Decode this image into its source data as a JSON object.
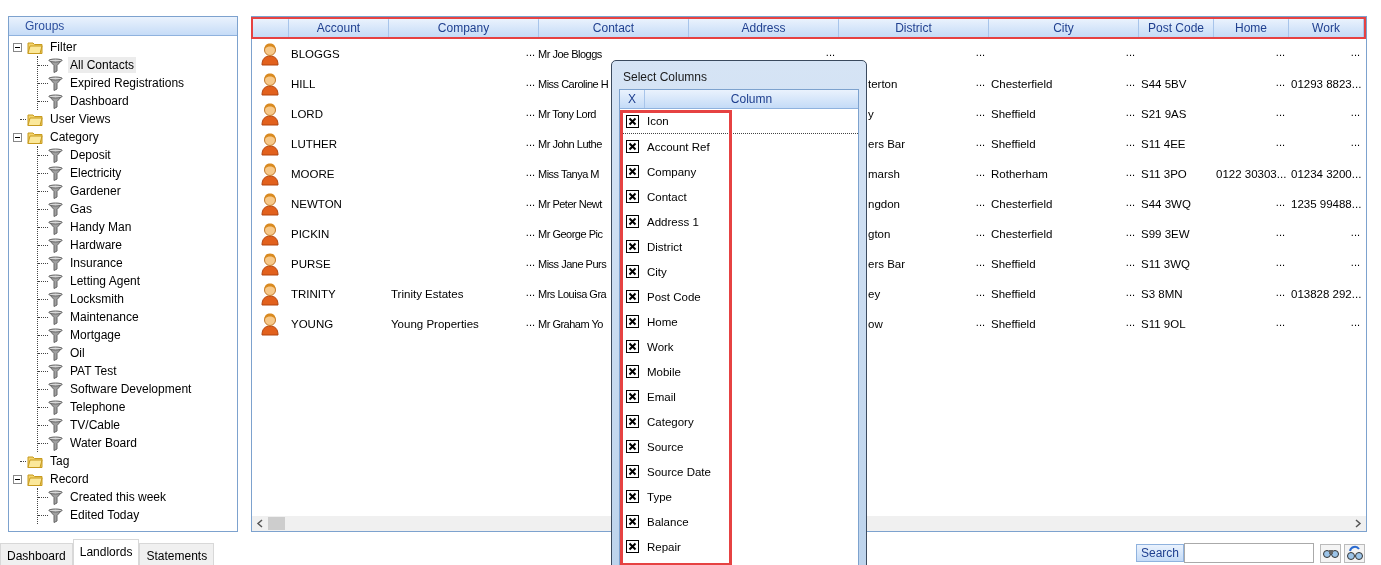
{
  "groups": {
    "title": "Groups",
    "items": [
      {
        "label": "Filter",
        "selected": false,
        "expanded": true,
        "children": [
          {
            "label": "All Contacts",
            "selected": true
          },
          {
            "label": "Expired Registrations",
            "selected": false
          },
          {
            "label": "Dashboard",
            "selected": false
          }
        ]
      },
      {
        "label": "User Views",
        "selected": false
      },
      {
        "label": "Category",
        "selected": false,
        "expanded": true,
        "children": [
          {
            "label": "Deposit",
            "selected": false
          },
          {
            "label": "Electricity",
            "selected": false
          },
          {
            "label": "Gardener",
            "selected": false
          },
          {
            "label": "Gas",
            "selected": false
          },
          {
            "label": "Handy Man",
            "selected": false
          },
          {
            "label": "Hardware",
            "selected": false
          },
          {
            "label": "Insurance",
            "selected": false
          },
          {
            "label": "Letting Agent",
            "selected": false
          },
          {
            "label": "Locksmith",
            "selected": false
          },
          {
            "label": "Maintenance",
            "selected": false
          },
          {
            "label": "Mortgage",
            "selected": false
          },
          {
            "label": "Oil",
            "selected": false
          },
          {
            "label": "PAT Test",
            "selected": false
          },
          {
            "label": "Software Development",
            "selected": false
          },
          {
            "label": "Telephone",
            "selected": false
          },
          {
            "label": "TV/Cable",
            "selected": false
          },
          {
            "label": "Water Board",
            "selected": false
          }
        ]
      },
      {
        "label": "Tag",
        "selected": false
      },
      {
        "label": "Record",
        "selected": false,
        "expanded": true,
        "children": [
          {
            "label": "Created this week",
            "selected": false
          },
          {
            "label": "Edited Today",
            "selected": false
          }
        ]
      }
    ]
  },
  "table": {
    "columns": [
      "Account",
      "Company",
      "Contact",
      "Address",
      "District",
      "City",
      "Post Code",
      "Home",
      "Work"
    ],
    "rows": [
      {
        "cells": [
          {
            "text": "BLOGGS"
          },
          {
            "more": "..."
          },
          {
            "text": "Mr Joe Bloggs"
          },
          {
            "more": "..."
          },
          {
            "more": "..."
          },
          {
            "more": "..."
          },
          {},
          {
            "more": "..."
          },
          {
            "more": "..."
          }
        ]
      },
      {
        "cells": [
          {
            "text": "HILL"
          },
          {
            "more": "..."
          },
          {
            "text": "Miss Caroline H"
          },
          {},
          {
            "text": "terton",
            "more": "..."
          },
          {
            "text": "Chesterfield",
            "more": "..."
          },
          {
            "text": "S44 5BV"
          },
          {
            "more": "..."
          },
          {
            "text": "01293 8823..."
          }
        ]
      },
      {
        "cells": [
          {
            "text": "LORD"
          },
          {
            "more": "..."
          },
          {
            "text": "Mr Tony Lord"
          },
          {},
          {
            "text": "y",
            "more": "..."
          },
          {
            "text": "Sheffield",
            "more": "..."
          },
          {
            "text": "S21 9AS"
          },
          {
            "more": "..."
          },
          {
            "more": "..."
          }
        ]
      },
      {
        "cells": [
          {
            "text": "LUTHER"
          },
          {
            "more": "..."
          },
          {
            "text": "Mr John Luthe"
          },
          {},
          {
            "text": "ers Bar",
            "more": "..."
          },
          {
            "text": "Sheffield",
            "more": "..."
          },
          {
            "text": "S11 4EE"
          },
          {
            "more": "..."
          },
          {
            "more": "..."
          }
        ]
      },
      {
        "cells": [
          {
            "text": "MOORE"
          },
          {
            "more": "..."
          },
          {
            "text": "Miss Tanya M"
          },
          {},
          {
            "text": "marsh",
            "more": "..."
          },
          {
            "text": "Rotherham",
            "more": "..."
          },
          {
            "text": "S11 3PO"
          },
          {
            "text": "0122 30303..."
          },
          {
            "text": "01234 3200..."
          }
        ]
      },
      {
        "cells": [
          {
            "text": "NEWTON"
          },
          {
            "more": "..."
          },
          {
            "text": "Mr Peter Newt"
          },
          {},
          {
            "text": "ngdon",
            "more": "..."
          },
          {
            "text": "Chesterfield",
            "more": "..."
          },
          {
            "text": "S44 3WQ"
          },
          {
            "more": "..."
          },
          {
            "text": "1235 99488..."
          }
        ]
      },
      {
        "cells": [
          {
            "text": "PICKIN"
          },
          {
            "more": "..."
          },
          {
            "text": "Mr George Pic"
          },
          {},
          {
            "text": "gton",
            "more": "..."
          },
          {
            "text": "Chesterfield",
            "more": "..."
          },
          {
            "text": "S99 3EW"
          },
          {
            "more": "..."
          },
          {
            "more": "..."
          }
        ]
      },
      {
        "cells": [
          {
            "text": "PURSE"
          },
          {
            "more": "..."
          },
          {
            "text": "Miss Jane Purs"
          },
          {},
          {
            "text": "ers Bar",
            "more": "..."
          },
          {
            "text": "Sheffield",
            "more": "..."
          },
          {
            "text": "S11 3WQ"
          },
          {
            "more": "..."
          },
          {
            "more": "..."
          }
        ]
      },
      {
        "cells": [
          {
            "text": "TRINITY"
          },
          {
            "text": "Trinity Estates",
            "more": "..."
          },
          {
            "text": "Mrs Louisa Gra"
          },
          {},
          {
            "text": "ey",
            "more": "..."
          },
          {
            "text": "Sheffield",
            "more": "..."
          },
          {
            "text": "S3 8MN"
          },
          {
            "more": "..."
          },
          {
            "text": "013828 292..."
          }
        ]
      },
      {
        "cells": [
          {
            "text": "YOUNG"
          },
          {
            "text": "Young Properties",
            "more": "..."
          },
          {
            "text": "Mr Graham Yo"
          },
          {},
          {
            "text": "ow",
            "more": "..."
          },
          {
            "text": "Sheffield",
            "more": "..."
          },
          {
            "text": "S11 9OL"
          },
          {
            "more": "..."
          },
          {
            "more": "..."
          }
        ]
      }
    ]
  },
  "select_columns": {
    "title": "Select Columns",
    "header": {
      "column_1": "X",
      "column_2": "Column"
    },
    "items": [
      {
        "label": "Icon",
        "checked": true
      },
      {
        "label": "Account Ref",
        "checked": true
      },
      {
        "label": "Company",
        "checked": true
      },
      {
        "label": "Contact",
        "checked": true
      },
      {
        "label": "Address 1",
        "checked": true
      },
      {
        "label": "District",
        "checked": true
      },
      {
        "label": "City",
        "checked": true
      },
      {
        "label": "Post Code",
        "checked": true
      },
      {
        "label": "Home",
        "checked": true
      },
      {
        "label": "Work",
        "checked": true
      },
      {
        "label": "Mobile",
        "checked": true
      },
      {
        "label": "Email",
        "checked": true
      },
      {
        "label": "Category",
        "checked": true
      },
      {
        "label": "Source",
        "checked": true
      },
      {
        "label": "Source Date",
        "checked": true
      },
      {
        "label": "Type",
        "checked": true
      },
      {
        "label": "Balance",
        "checked": true
      },
      {
        "label": "Repair",
        "checked": true
      }
    ]
  },
  "tabs": [
    {
      "label": "Dashboard",
      "selected": false
    },
    {
      "label": "Landlords",
      "selected": true
    },
    {
      "label": "Statements",
      "selected": false
    }
  ],
  "search": {
    "button": "Search"
  }
}
